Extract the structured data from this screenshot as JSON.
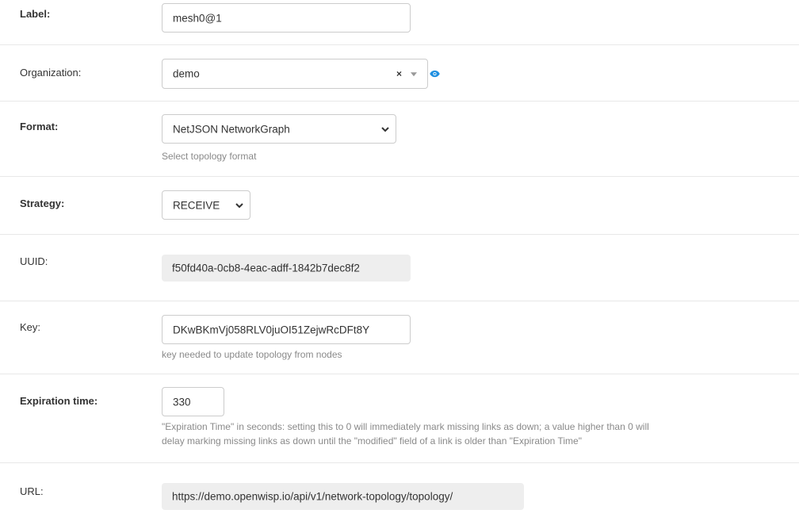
{
  "form": {
    "label": {
      "label": "Label:",
      "value": "mesh0@1"
    },
    "organization": {
      "label": "Organization:",
      "value": "demo",
      "clear_glyph": "×",
      "icon": "eye-icon"
    },
    "format": {
      "label": "Format:",
      "value": "NetJSON NetworkGraph",
      "help": "Select topology format"
    },
    "strategy": {
      "label": "Strategy:",
      "value": "RECEIVE"
    },
    "uuid": {
      "label": "UUID:",
      "value": "f50fd40a-0cb8-4eac-adff-1842b7dec8f2"
    },
    "key": {
      "label": "Key:",
      "value": "DKwBKmVj058RLV0juOI51ZejwRcDFt8Y",
      "help": "key needed to update topology from nodes"
    },
    "expiration": {
      "label": "Expiration time:",
      "value": "330",
      "help_line1": "\"Expiration Time\" in seconds: setting this to 0 will immediately mark missing links as down; a value higher than 0 will",
      "help_line2": "delay marking missing links as down until the \"modified\" field of a link is older than \"Expiration Time\""
    },
    "url": {
      "label": "URL:",
      "value": "https://demo.openwisp.io/api/v1/network-topology/topology/"
    }
  },
  "colors": {
    "accent": "#1f8fe0",
    "border": "#cccccc",
    "readonly_bg": "#eeeeee",
    "help_text": "#8a8a8a"
  }
}
